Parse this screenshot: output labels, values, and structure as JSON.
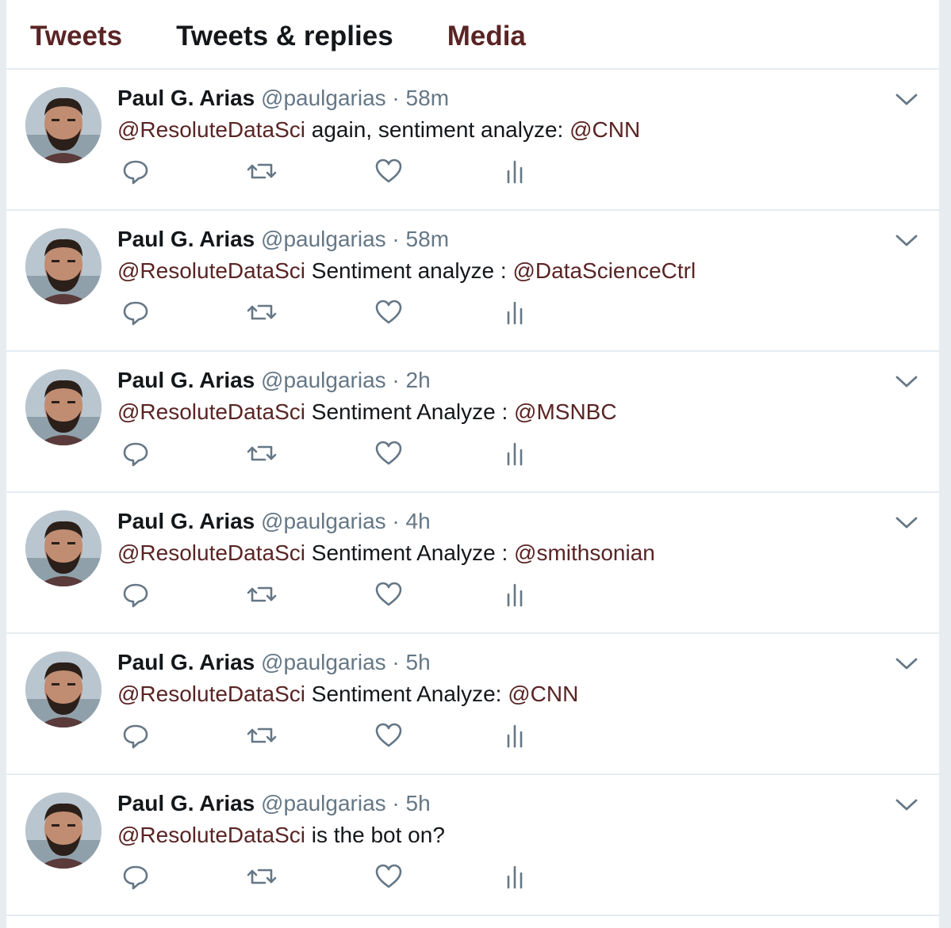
{
  "tabs": [
    {
      "label": "Tweets"
    },
    {
      "label": "Tweets & replies"
    },
    {
      "label": "Media"
    }
  ],
  "colors": {
    "accent": "#5a2424",
    "text": "#14171a",
    "secondary": "#657786",
    "divider": "#e6ecf0",
    "background": "#e6ecf0"
  },
  "icons": {
    "reply": "reply-icon",
    "retweet": "retweet-icon",
    "like": "like-icon",
    "analytics": "analytics-icon",
    "caret": "chevron-down-icon"
  },
  "tweets": [
    {
      "name": "Paul G. Arias",
      "handle": "@paulgarias",
      "time": "58m",
      "mention": "@ResoluteDataSci",
      "body": "again, sentiment analyze:",
      "target": "@CNN"
    },
    {
      "name": "Paul G. Arias",
      "handle": "@paulgarias",
      "time": "58m",
      "mention": "@ResoluteDataSci",
      "body": "Sentiment analyze :",
      "target": "@DataScienceCtrl"
    },
    {
      "name": "Paul G. Arias",
      "handle": "@paulgarias",
      "time": "2h",
      "mention": "@ResoluteDataSci",
      "body": "Sentiment Analyze :",
      "target": "@MSNBC"
    },
    {
      "name": "Paul G. Arias",
      "handle": "@paulgarias",
      "time": "4h",
      "mention": "@ResoluteDataSci",
      "body": "Sentiment Analyze :",
      "target": "@smithsonian"
    },
    {
      "name": "Paul G. Arias",
      "handle": "@paulgarias",
      "time": "5h",
      "mention": "@ResoluteDataSci",
      "body": "Sentiment Analyze:",
      "target": "@CNN"
    },
    {
      "name": "Paul G. Arias",
      "handle": "@paulgarias",
      "time": "5h",
      "mention": "@ResoluteDataSci",
      "body": "is the bot on?",
      "target": ""
    }
  ]
}
